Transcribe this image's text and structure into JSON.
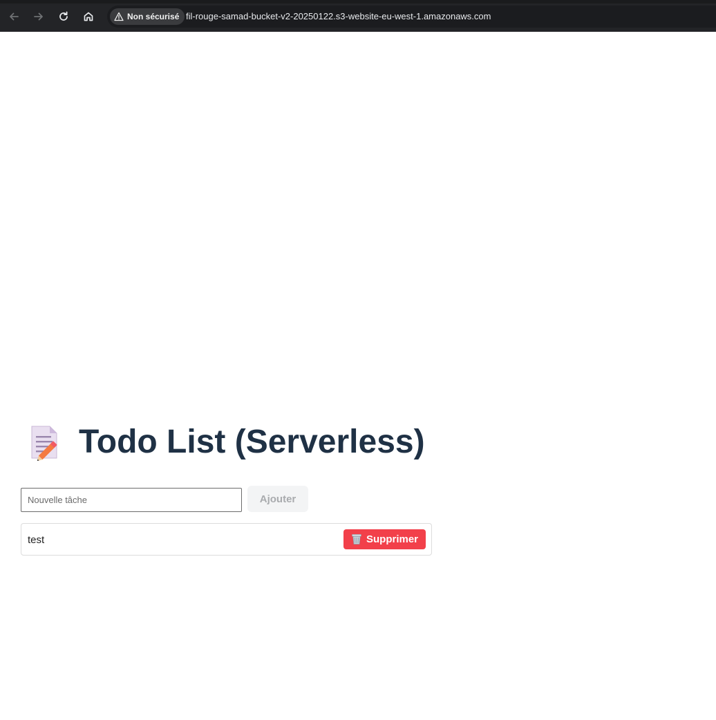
{
  "browser": {
    "security_label": "Non sécurisé",
    "url": "fil-rouge-samad-bucket-v2-20250122.s3-website-eu-west-1.amazonaws.com",
    "icons": [
      "back-arrow-icon",
      "forward-arrow-icon",
      "reload-icon",
      "home-icon",
      "warning-icon"
    ]
  },
  "app": {
    "title": "Todo List (Serverless)",
    "title_icon": "memo-icon",
    "input_placeholder": "Nouvelle tâche",
    "input_value": "",
    "add_label": "Ajouter",
    "todos": [
      {
        "text": "test",
        "delete_label": "Supprimer",
        "delete_icon": "wastebasket-icon"
      }
    ]
  },
  "colors": {
    "title": "#1f3145",
    "delete_button": "#f2404a",
    "add_button_bg": "#f3f4f5",
    "add_button_text": "#a9abae"
  }
}
